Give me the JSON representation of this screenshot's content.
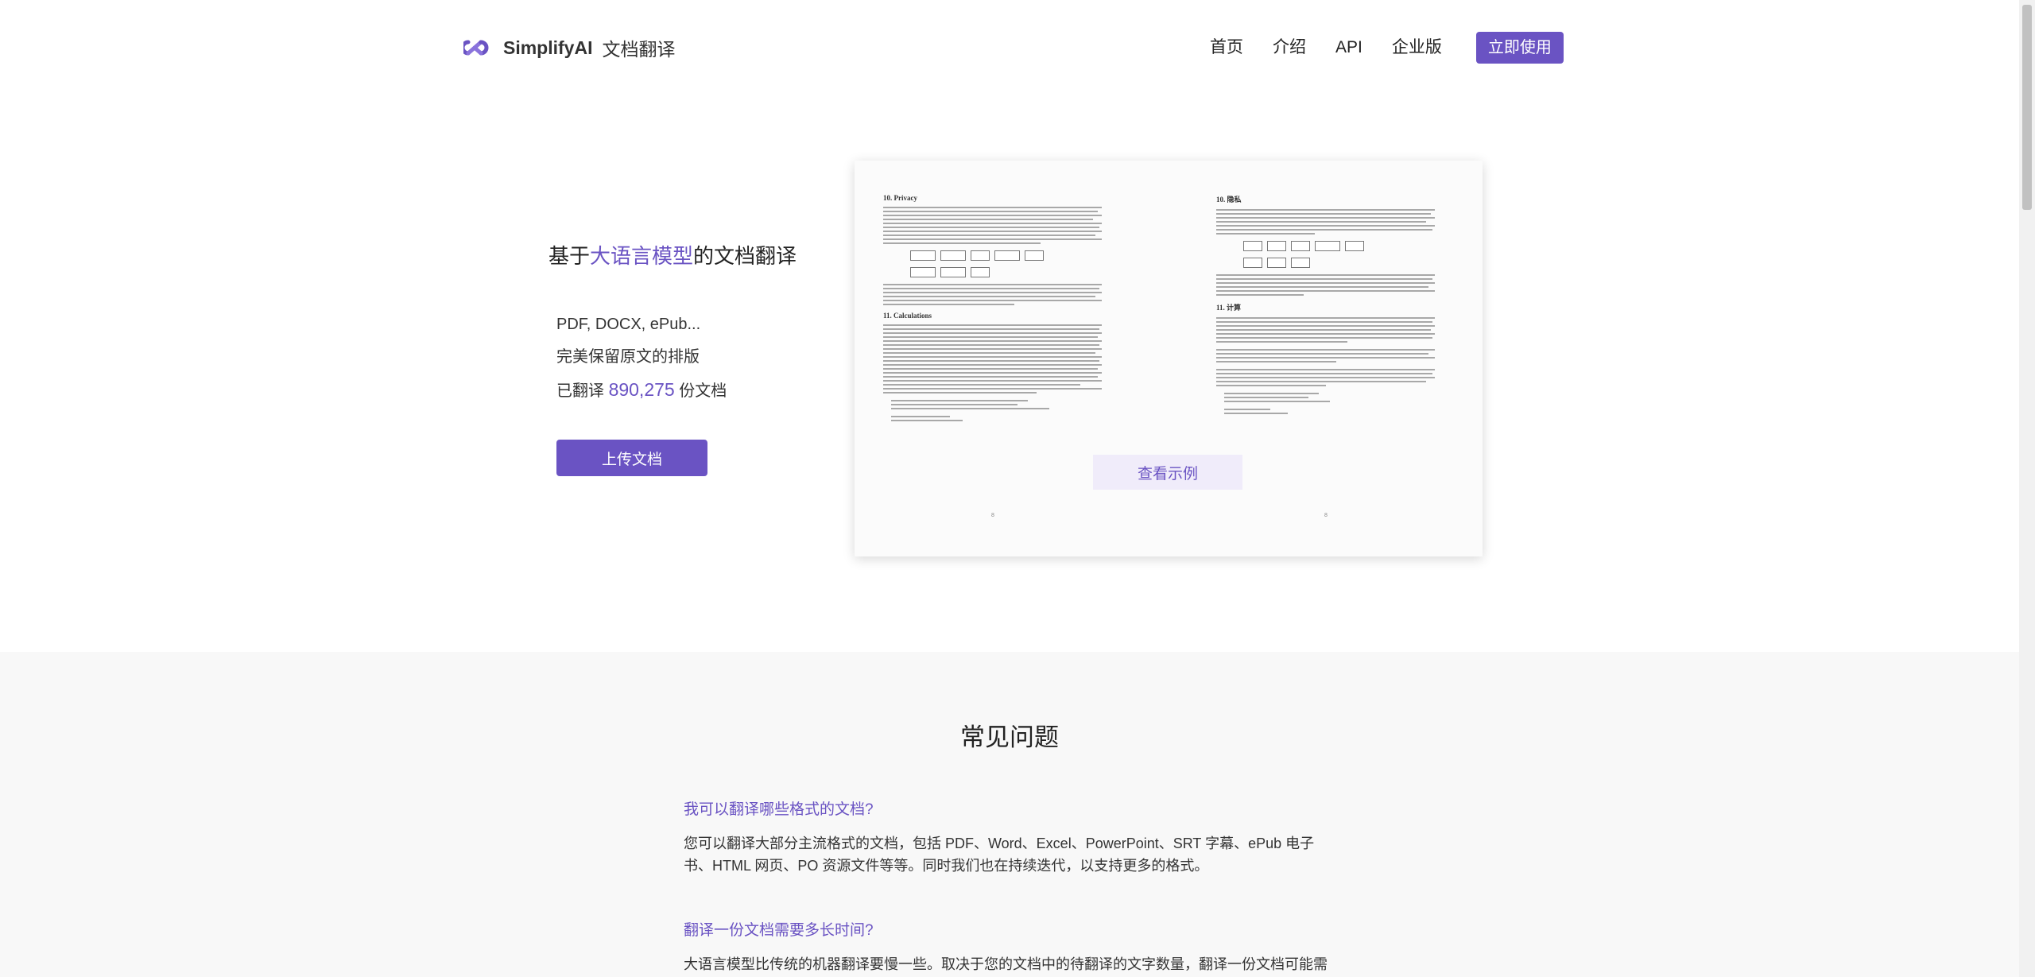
{
  "brand": {
    "name": "SimplifyAI",
    "subtitle": "文档翻译",
    "accent": "#6a53c3"
  },
  "nav": {
    "items": [
      "首页",
      "介绍",
      "API",
      "企业版"
    ],
    "cta": "立即使用"
  },
  "hero": {
    "title_prefix": "基于",
    "title_highlight": "大语言模型",
    "title_suffix": "的文档翻译",
    "formats": "PDF, DOCX, ePub...",
    "layout_note": "完美保留原文的排版",
    "count_prefix": "已翻译",
    "count_value": "890,275",
    "count_suffix": "份文档",
    "upload_button": "上传文档",
    "view_example": "查看示例"
  },
  "preview": {
    "left_heading_1": "10.  Privacy",
    "left_heading_2": "11.  Calculations",
    "right_heading_1": "10. 隐私",
    "right_heading_2": "11. 计算",
    "left_page_number": "8",
    "right_page_number": "8"
  },
  "faq": {
    "title": "常见问题",
    "items": [
      {
        "q": "我可以翻译哪些格式的文档?",
        "a": "您可以翻译大部分主流格式的文档，包括 PDF、Word、Excel、PowerPoint、SRT 字幕、ePub 电子书、HTML 网页、PO 资源文件等等。同时我们也在持续迭代，以支持更多的格式。"
      },
      {
        "q": "翻译一份文档需要多长时间?",
        "a": "大语言模型比传统的机器翻译要慢一些。取决于您的文档中的待翻译的文字数量，翻译一份文档可能需"
      }
    ]
  }
}
